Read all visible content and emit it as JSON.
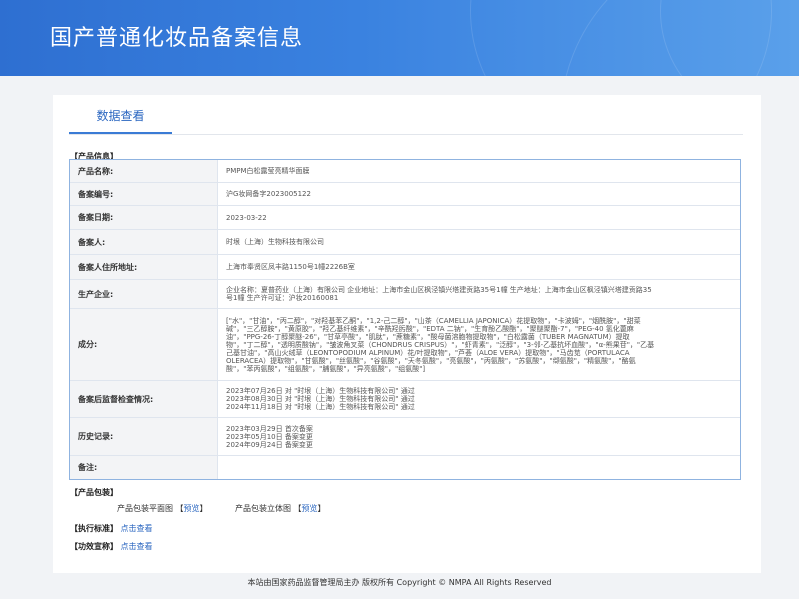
{
  "page": {
    "title": "国产普通化妆品备案信息",
    "footer": "本站由国家药品监督管理局主办 版权所有 Copyright © NMPA All Rights Reserved"
  },
  "tabs": [
    {
      "label": "数据查看"
    }
  ],
  "sections": {
    "product_info": "【产品信息】",
    "packaging": "【产品包装】",
    "standard": "【执行标准】",
    "efficacy": "【功效宣称】"
  },
  "info_rows": [
    {
      "label": "产品名称:",
      "value": "PMPM白松露莹亮精华面膜"
    },
    {
      "label": "备案编号:",
      "value": "沪G妆网备字2023005122"
    },
    {
      "label": "备案日期:",
      "value": "2023-03-22"
    },
    {
      "label": "备案人:",
      "value": "时垠（上海）生物科技有限公司"
    },
    {
      "label": "备案人住所地址:",
      "value": "上海市奉贤区凤丰路1150号1幢2226B室"
    },
    {
      "label": "生产企业:",
      "lines": [
        "企业名称：夏普药业（上海）有限公司 企业地址：上海市金山区枫泾镇兴塔建贡路35号1幢 生产地址：上海市金山区枫泾镇兴塔建贡路35",
        "号1幢 生产许可证：沪妆20160081"
      ]
    },
    {
      "label": "成分:",
      "lines": [
        "[\"水\"，\"甘油\"，\"丙二醇\"，\"对羟基苯乙酮\"，\"1,2-己二醇\"，\"山茶（CAMELLIA JAPONICA）花提取物\"，\"卡波姆\"，\"烟酰胺\"，\"甜菜",
        "碱\"，\"三乙醇胺\"，\"黄原胶\"，\"羟乙基纤维素\"，\"辛酰羟肟酸\"，\"EDTA 二钠\"，\"生育酚乙酸酯\"，\"聚醚聚酯-7\"，\"PEG-40 氢化蓖麻",
        "油\"，\"PPG-26-丁醇聚醚-26\"，\"甘草亭酸\"，\"肌肽\"，\"蔗糖素\"，\"酸母菌溶胞物提取物\"，\"白松露菌（TUBER MAGNATUM）提取",
        "物\"，\"丁二醇\"，\"透明质酸钠\"，\"皱波角叉菜（CHONDRUS CRISPUS）\"，\"虾青素\"，\"泛醇\"，\"3-邻-乙基抗坏血酸\"，\"α-熊果苷\"，\"乙基",
        "己基甘油\"，\"高山火绒草（LEONTOPODIUM ALPINUM）花/叶提取物\"，\"芦荟（ALOE VERA）提取物\"，\"马齿苋（PORTULACA",
        "OLERACEA）提取物\"，\"甘氨酸\"，\"丝氨酸\"，\"谷氨酸\"，\"天冬氨酸\"，\"亮氨酸\"，\"丙氨酸\"，\"苏氨酸\"，\"缬氨酸\"，\"精氨酸\"，\"酪氨",
        "酸\"，\"苯丙氨酸\"，\"组氨酸\"，\"脯氨酸\"，\"异亮氨酸\"，\"组氨酸\"]"
      ]
    },
    {
      "label": "备案后监督检查情况:",
      "lines": [
        "2023年07月26日 对 \"时垠（上海）生物科技有限公司\" 通过",
        "2023年08月30日 对 \"时垠（上海）生物科技有限公司\" 通过",
        "2024年11月18日 对 \"时垠（上海）生物科技有限公司\" 通过"
      ]
    },
    {
      "label": "历史记录:",
      "lines": [
        "2023年03月29日 首次备案",
        "2023年05月10日 备案变更",
        "2024年09月24日 备案变更"
      ]
    },
    {
      "label": "备注:",
      "value": ""
    }
  ],
  "packaging": {
    "flat_label": "产品包装平面图",
    "flat_link": "预览",
    "solid_label": "产品包装立体图",
    "solid_link": "预览",
    "bracket_open": "【",
    "bracket_close": "】"
  },
  "standard_link": "点击查看",
  "efficacy_link": "点击查看",
  "colors": {
    "banner": "#3a7bd5",
    "accent": "#2a66c0",
    "table_border": "#8fb3e0"
  }
}
